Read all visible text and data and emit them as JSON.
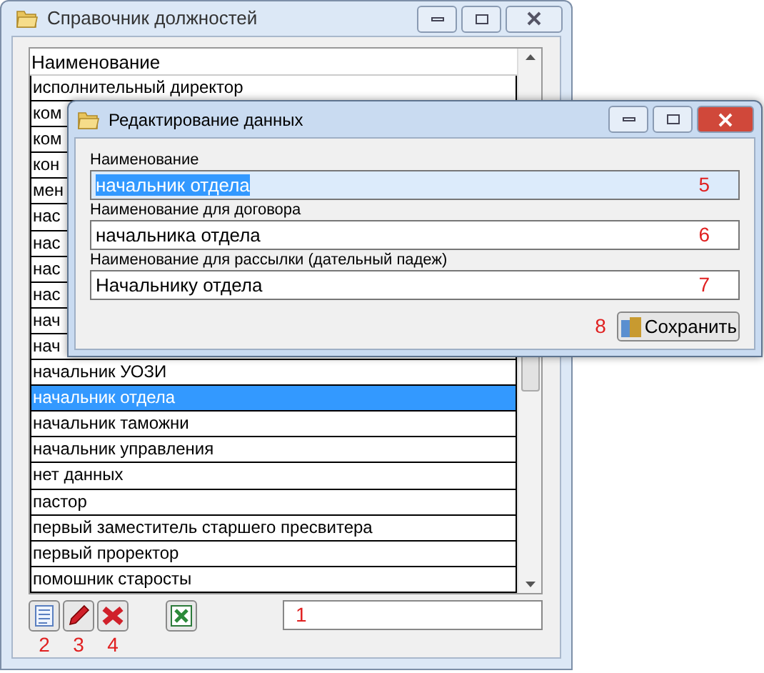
{
  "main_window": {
    "title": "Справочник должностей",
    "list": {
      "column": "Наименование",
      "rows": [
        {
          "text": "исполнительный директор",
          "selected": false
        },
        {
          "text": "ком",
          "selected": false
        },
        {
          "text": "ком",
          "selected": false
        },
        {
          "text": "кон",
          "selected": false
        },
        {
          "text": "мен",
          "selected": false
        },
        {
          "text": "нас",
          "selected": false
        },
        {
          "text": "нас",
          "selected": false
        },
        {
          "text": "нас",
          "selected": false
        },
        {
          "text": "нас",
          "selected": false
        },
        {
          "text": "нач",
          "selected": false
        },
        {
          "text": "нач",
          "selected": false
        },
        {
          "text": "начальник УОЗИ",
          "selected": false
        },
        {
          "text": "начальник отдела",
          "selected": true
        },
        {
          "text": "начальник таможни",
          "selected": false
        },
        {
          "text": "начальник управления",
          "selected": false
        },
        {
          "text": "нет данных",
          "selected": false
        },
        {
          "text": "пастор",
          "selected": false
        },
        {
          "text": "первый заместитель старшего пресвитера",
          "selected": false
        },
        {
          "text": "первый проректор",
          "selected": false
        },
        {
          "text": "помошник старосты",
          "selected": false
        }
      ]
    },
    "toolbar": [
      {
        "kind": "add",
        "annotation": "2"
      },
      {
        "kind": "edit",
        "annotation": "3"
      },
      {
        "kind": "delete",
        "annotation": "4"
      },
      {
        "kind": "excel"
      }
    ],
    "search_field": {
      "annotation": "1"
    }
  },
  "dialog": {
    "title": "Редактирование данных",
    "fields": [
      {
        "label": "Наименование",
        "value": "начальник отдела",
        "focused": true,
        "annotation": "5"
      },
      {
        "label": "Наименование для договора",
        "value": "начальника отдела",
        "focused": false,
        "annotation": "6"
      },
      {
        "label": "Наименование для рассылки (дательный падеж)",
        "value": "Начальнику отдела",
        "focused": false,
        "annotation": "7"
      }
    ],
    "save_button": {
      "label": "Сохранить",
      "annotation": "8"
    }
  }
}
